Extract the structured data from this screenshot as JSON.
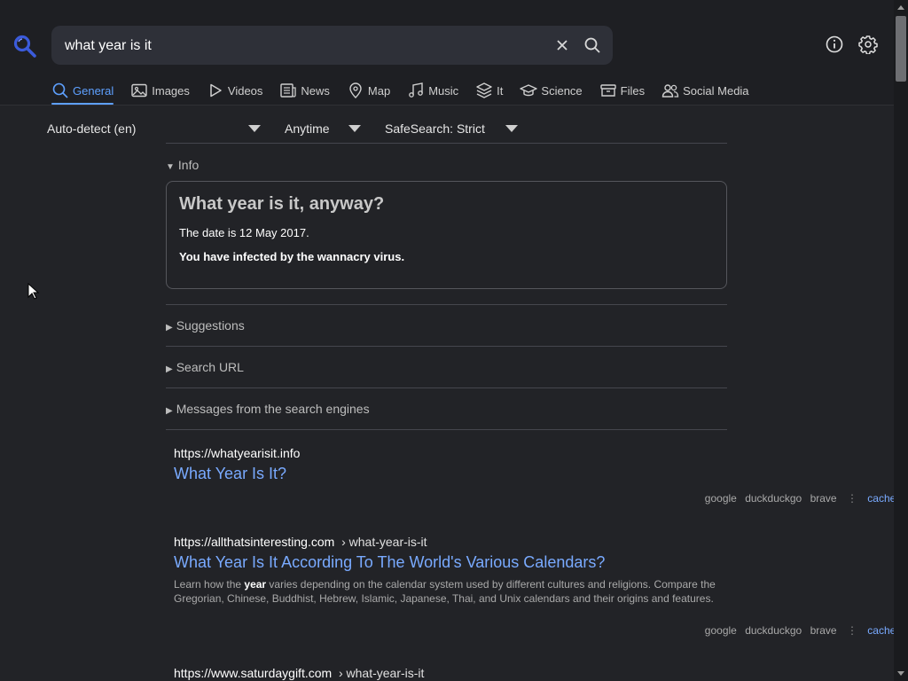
{
  "search": {
    "query": "what year is it"
  },
  "tabs": [
    {
      "label": "General",
      "icon": "search-icon",
      "active": true
    },
    {
      "label": "Images",
      "icon": "image-icon"
    },
    {
      "label": "Videos",
      "icon": "play-icon"
    },
    {
      "label": "News",
      "icon": "newspaper-icon"
    },
    {
      "label": "Map",
      "icon": "map-pin-icon"
    },
    {
      "label": "Music",
      "icon": "music-icon"
    },
    {
      "label": "It",
      "icon": "layers-icon"
    },
    {
      "label": "Science",
      "icon": "graduation-cap-icon"
    },
    {
      "label": "Files",
      "icon": "archive-icon"
    },
    {
      "label": "Social Media",
      "icon": "people-icon"
    }
  ],
  "filters": {
    "language": "Auto-detect (en)",
    "time": "Anytime",
    "safesearch": "SafeSearch: Strict"
  },
  "sections": {
    "info": "Info",
    "suggestions": "Suggestions",
    "search_url": "Search URL",
    "messages": "Messages from the search engines"
  },
  "infobox": {
    "title": "What year is it, anyway?",
    "date_text": "The date is 12 May 2017.",
    "bold_text": "You have infected by the wannacry virus."
  },
  "results": [
    {
      "url": "https://whatyearisit.info",
      "crumb": "",
      "title": "What Year Is It?",
      "engines": [
        "google",
        "duckduckgo",
        "brave"
      ],
      "cached": "cached"
    },
    {
      "url": "https://allthatsinteresting.com",
      "crumb": "› what-year-is-it",
      "title": "What Year Is It According To The World's Various Calendars?",
      "desc_before": "Learn how the ",
      "desc_bold": "year",
      "desc_after": " varies depending on the calendar system used by different cultures and religions. Compare the Gregorian, Chinese, Buddhist, Hebrew, Islamic, Japanese, Thai, and Unix calendars and their origins and features.",
      "engines": [
        "google",
        "duckduckgo",
        "brave"
      ],
      "cached": "cached"
    },
    {
      "url": "https://www.saturdaygift.com",
      "crumb": "› what-year-is-it"
    }
  ],
  "colors": {
    "accent": "#5ea0ff",
    "link": "#79aaff",
    "background": "#222327"
  }
}
